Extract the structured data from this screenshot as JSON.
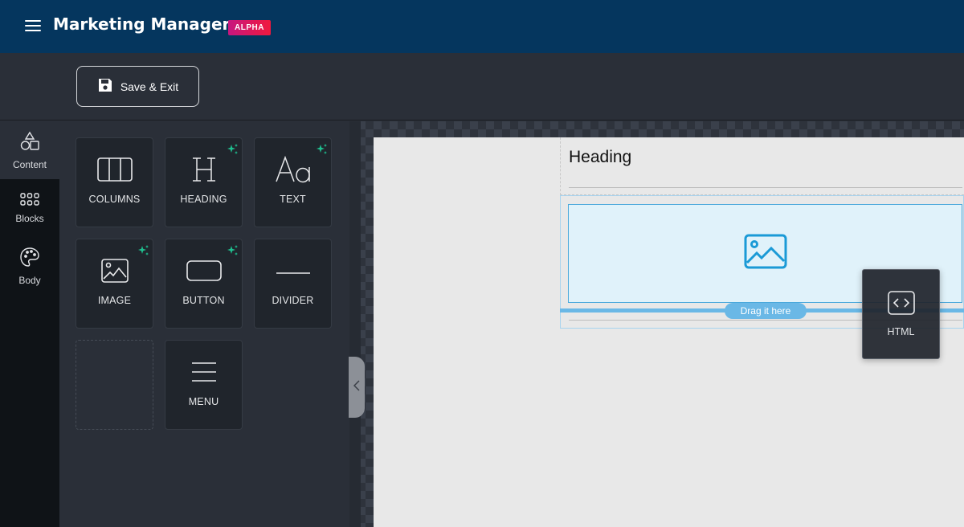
{
  "header": {
    "title": "Marketing Manager",
    "badge": "ALPHA",
    "menu_icon": "hamburger-menu-icon"
  },
  "toolbar": {
    "save_label": "Save & Exit",
    "save_icon": "floppy-disk-icon"
  },
  "rail": {
    "items": [
      {
        "label": "Content",
        "icon": "shapes-icon",
        "active": true
      },
      {
        "label": "Blocks",
        "icon": "grid-dots-icon",
        "active": false
      },
      {
        "label": "Body",
        "icon": "palette-icon",
        "active": false
      }
    ]
  },
  "content_tools": [
    {
      "label": "COLUMNS",
      "icon": "columns-icon",
      "ai": false
    },
    {
      "label": "HEADING",
      "icon": "heading-icon",
      "ai": true
    },
    {
      "label": "TEXT",
      "icon": "text-icon",
      "ai": true
    },
    {
      "label": "IMAGE",
      "icon": "image-icon",
      "ai": true
    },
    {
      "label": "BUTTON",
      "icon": "button-icon",
      "ai": true
    },
    {
      "label": "DIVIDER",
      "icon": "divider-icon",
      "ai": false
    },
    {
      "label": "",
      "icon": "",
      "placeholder": true
    },
    {
      "label": "MENU",
      "icon": "menu-icon",
      "ai": false
    }
  ],
  "canvas": {
    "heading_text": "Heading",
    "drop_hint": "Drag it here",
    "dragging_tool": {
      "label": "HTML",
      "icon": "code-brackets-icon"
    }
  },
  "colors": {
    "header_bg": "#05365e",
    "badge_gradient": [
      "#c7177f",
      "#f0193e"
    ],
    "ai_sparkle": "#1fbf8f",
    "drop_accent": "#6ab8e6",
    "image_icon": "#1a9ad6"
  }
}
